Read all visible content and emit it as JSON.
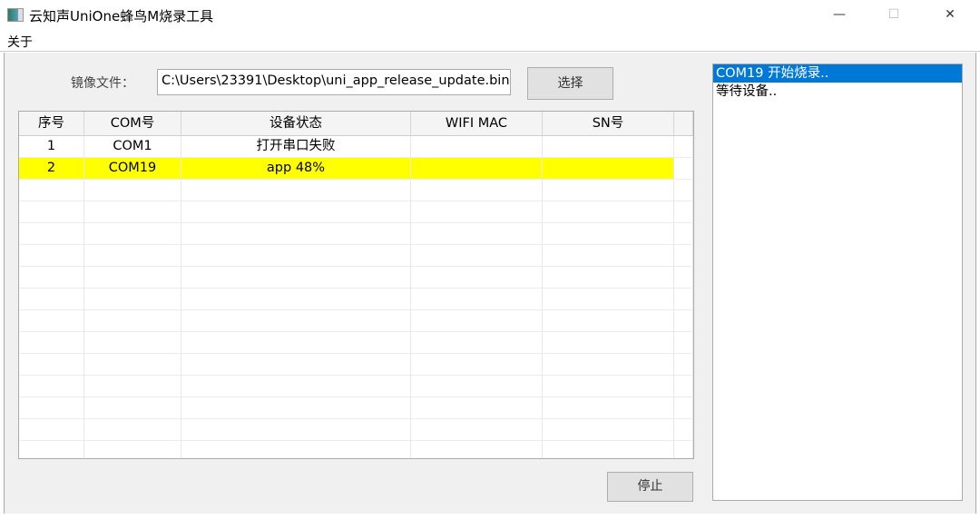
{
  "window": {
    "title": "云知声UniOne蜂鸟M烧录工具",
    "minimize": "—",
    "maximize": "☐",
    "close": "✕"
  },
  "menu": {
    "about": "关于"
  },
  "form": {
    "image_label": "镜像文件：",
    "image_path": "C:\\Users\\23391\\Desktop\\uni_app_release_update.bin",
    "select_button": "选择",
    "stop_button": "停止"
  },
  "table": {
    "columns": [
      "序号",
      "COM号",
      "设备状态",
      "WIFI MAC",
      "SN号"
    ],
    "rows": [
      {
        "no": "1",
        "com": "COM1",
        "status": "打开串口失败",
        "mac": "",
        "sn": "",
        "highlight": false
      },
      {
        "no": "2",
        "com": "COM19",
        "status": "app 48%",
        "mac": "",
        "sn": "",
        "highlight": true
      }
    ],
    "highlight_color": "#ffff00"
  },
  "log": {
    "lines": [
      "COM19 开始烧录..",
      "等待设备.."
    ]
  }
}
